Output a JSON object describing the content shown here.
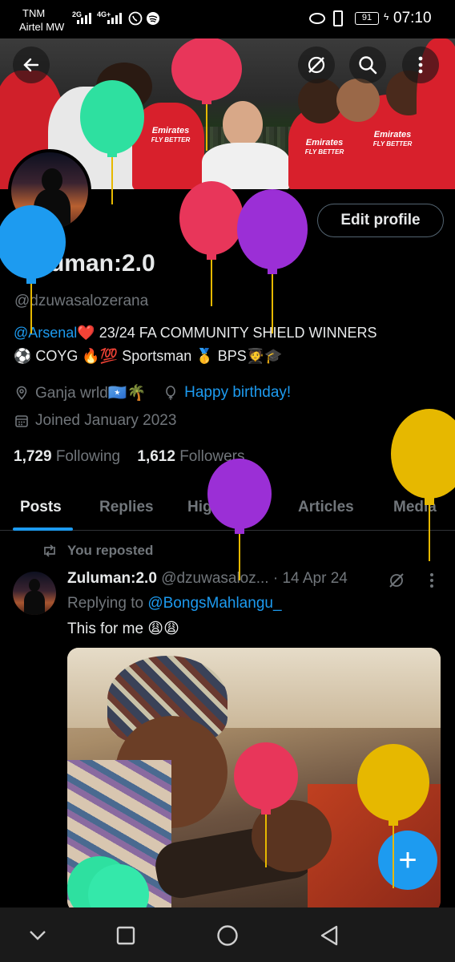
{
  "status_bar": {
    "carrier_top": "TNM",
    "carrier_bottom": "Airtel MW",
    "network_1": "2G",
    "network_2": "4G+",
    "battery": "91",
    "time": "07:10",
    "icons": [
      "signal-icon",
      "whatsapp-icon",
      "spotify-icon",
      "eye-icon",
      "vibrate-icon",
      "battery-icon",
      "charging-icon"
    ]
  },
  "header": {
    "back_icon": "arrow-left-icon",
    "grok_icon": "grok-icon",
    "search_icon": "search-icon",
    "more_icon": "more-vertical-icon"
  },
  "profile": {
    "edit_button": "Edit profile",
    "name": "Zuluman:2.0",
    "handle": "@dzuwasalozerana",
    "bio_line1_link": "@Arsenal",
    "bio_line1_text": "❤️ 23/24 FA COMMUNITY SHIELD WINNERS",
    "bio_line2": "⚽ COYG 🔥💯 Sportsman 🥇 BPS🧑‍🎓🎓",
    "location": "Ganja wrld🇸🇴🌴",
    "birthday_text": "Happy birthday!",
    "joined": "Joined January 2023",
    "following_count": "1,729",
    "following_label": "Following",
    "followers_count": "1,612",
    "followers_label": "Followers"
  },
  "banner": {
    "shirt_sponsor_1": "Emirates",
    "shirt_sponsor_2": "FLY BETTER"
  },
  "tabs": [
    {
      "label": "Posts",
      "active": true
    },
    {
      "label": "Replies",
      "active": false
    },
    {
      "label": "Highlights",
      "active": false
    },
    {
      "label": "Articles",
      "active": false
    },
    {
      "label": "Media",
      "active": false
    }
  ],
  "post": {
    "repost_label": "You reposted",
    "author_name": "Zuluman:2.0",
    "author_handle": "@dzuwasaloz...",
    "date": "· 14 Apr 24",
    "replying_prefix": "Replying to ",
    "replying_handle": "@BongsMahlangu_",
    "text": "This for me 😩😩"
  },
  "fab": {
    "label": "+"
  },
  "nav": {
    "back_icon": "chevron-down-icon",
    "recents_icon": "square-icon",
    "home_icon": "circle-icon",
    "back_triangle_icon": "triangle-back-icon"
  },
  "colors": {
    "accent": "#1d9bf0",
    "text_primary": "#e7e9ea",
    "text_secondary": "#71767b",
    "background": "#000000",
    "balloon_red": "#e8365a",
    "balloon_green": "#2ee0a0",
    "balloon_purple": "#9b2fd6",
    "balloon_yellow": "#e6b800",
    "balloon_blue": "#1d9bf0"
  }
}
